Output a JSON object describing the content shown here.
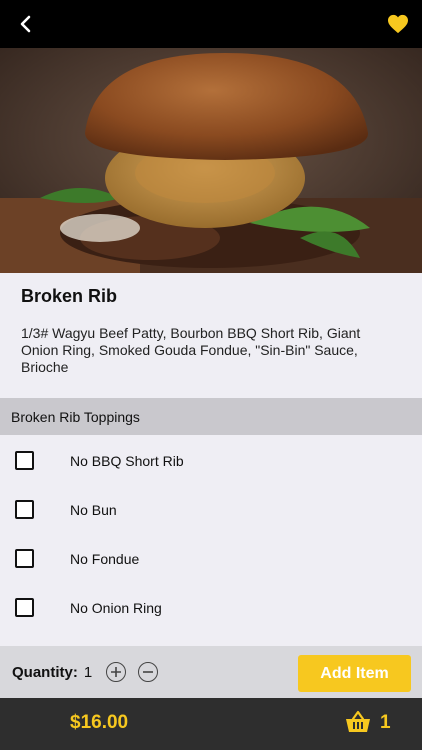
{
  "header": {
    "back_icon": "chevron-left-icon",
    "favorite_icon": "heart-icon"
  },
  "colors": {
    "accent": "#f7c81f",
    "topbar": "#000000",
    "bottombar": "#2e2e2e"
  },
  "item": {
    "name": "Broken Rib",
    "description": "1/3# Wagyu Beef Patty, Bourbon BBQ Short Rib, Giant Onion Ring, Smoked Gouda Fondue, \"Sin-Bin\" Sauce, Brioche"
  },
  "toppings": {
    "title": "Broken Rib Toppings",
    "options": [
      {
        "label": "No BBQ Short Rib",
        "checked": false
      },
      {
        "label": "No Bun",
        "checked": false
      },
      {
        "label": "No Fondue",
        "checked": false
      },
      {
        "label": "No Onion Ring",
        "checked": false
      }
    ]
  },
  "quantity": {
    "label": "Quantity:",
    "value": "1",
    "plus_icon": "plus-circle-icon",
    "minus_icon": "minus-circle-icon"
  },
  "actions": {
    "add_item_label": "Add Item"
  },
  "footer": {
    "price": "$16.00",
    "cart_icon": "basket-icon",
    "cart_count": "1"
  }
}
